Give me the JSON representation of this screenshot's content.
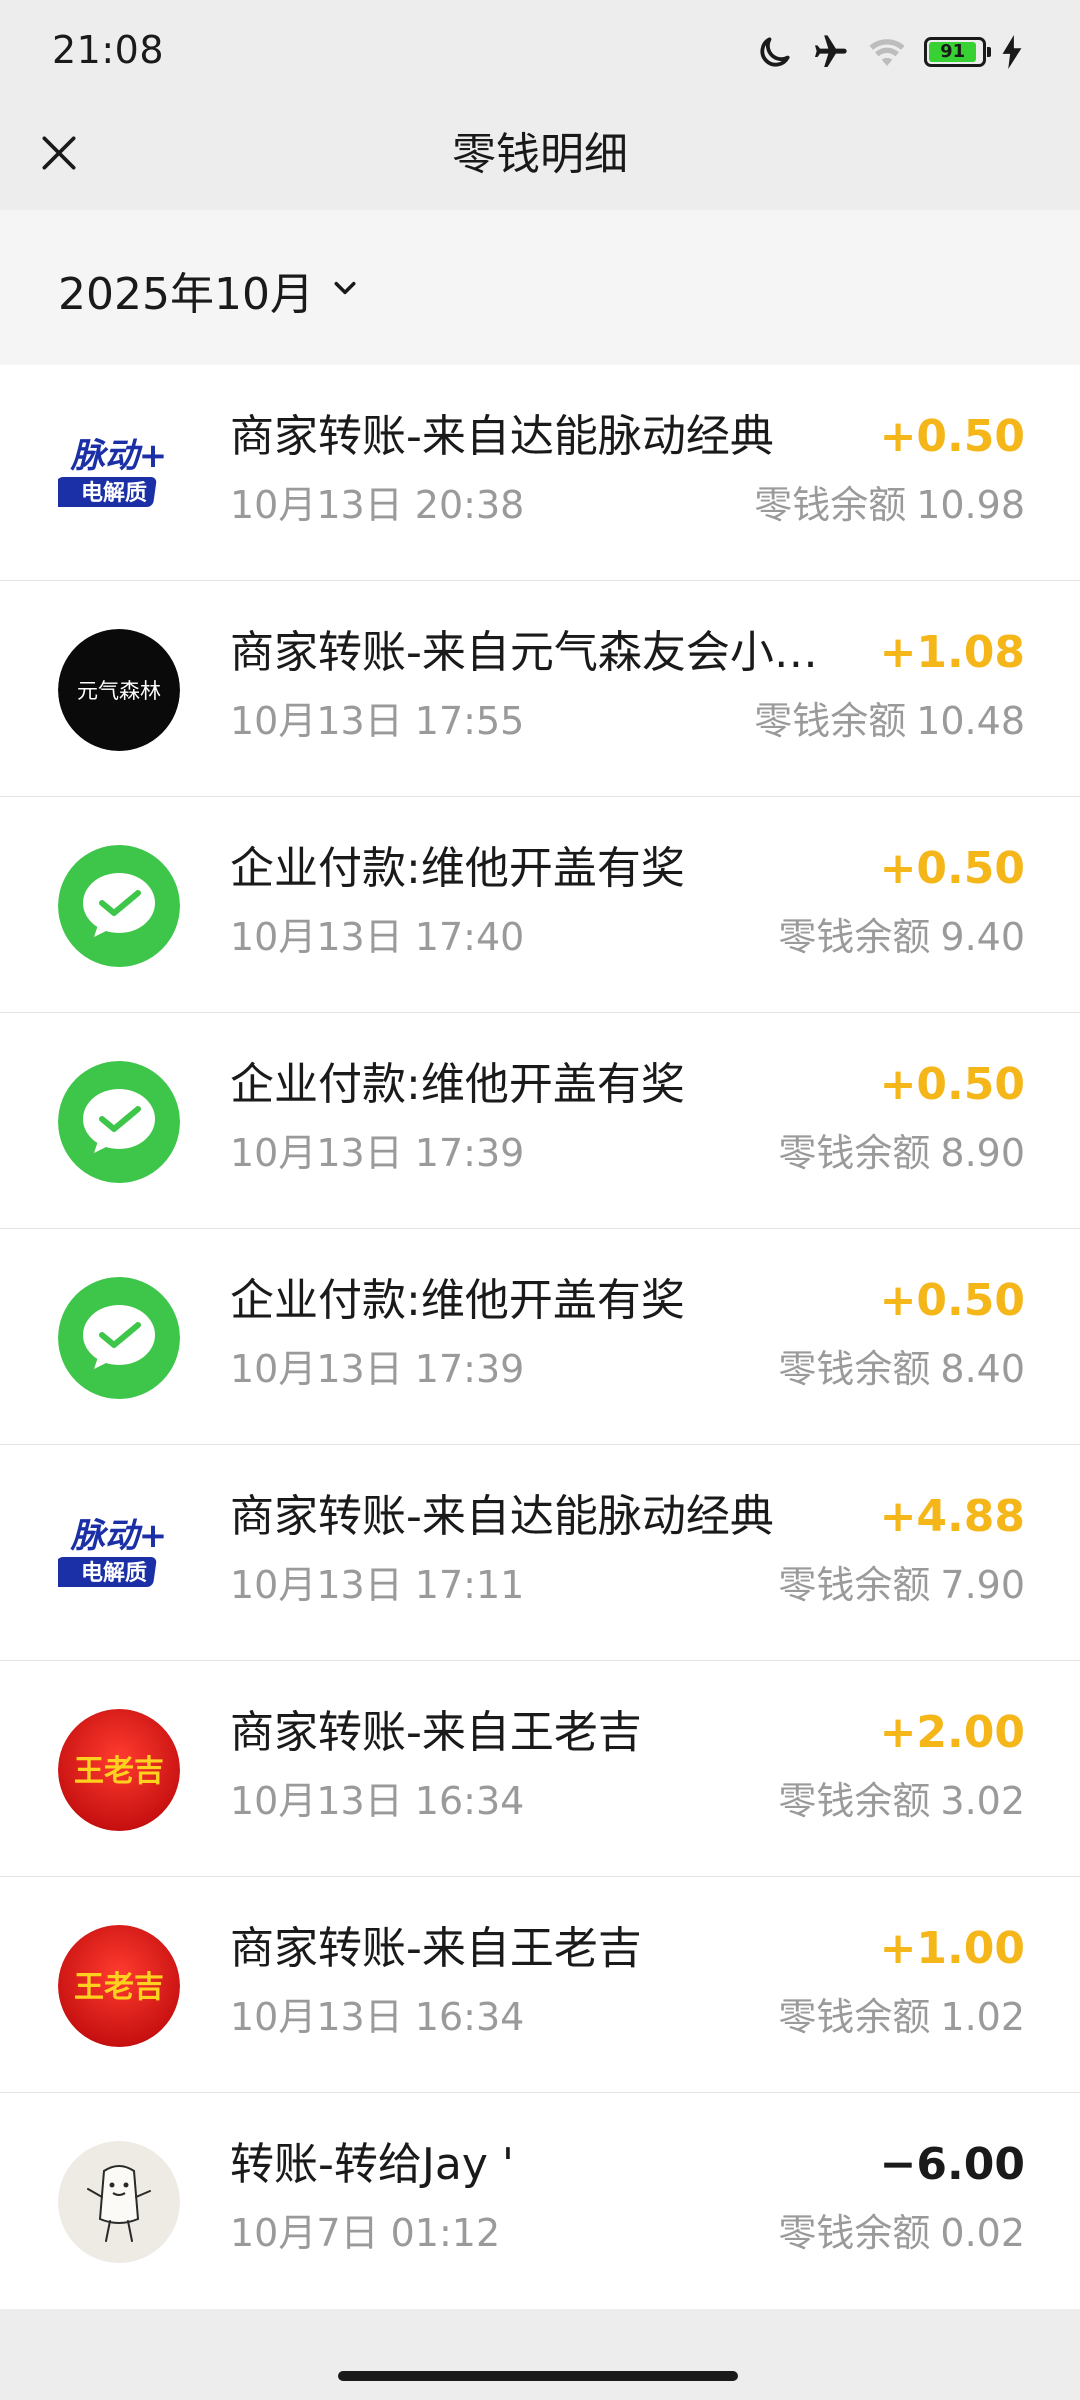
{
  "status_bar": {
    "time": "21:08",
    "battery_level": "91",
    "icons": [
      "moon-icon",
      "airplane-icon",
      "wifi-icon",
      "battery-icon",
      "charging-icon"
    ]
  },
  "nav": {
    "title": "零钱明细",
    "close_icon": "close-icon"
  },
  "filter": {
    "month_label": "2025年10月",
    "chevron_icon": "chevron-down-icon"
  },
  "balance_label": "零钱余额",
  "colors": {
    "income": "#f5b61a",
    "expense": "#1a1a1a",
    "wechat_green": "#3ec64a"
  },
  "transactions": [
    {
      "title": "商家转账-来自达能脉动经典",
      "time": "10月13日 20:38",
      "amount": "+0.50",
      "balance": "10.98",
      "avatar": "maidong-logo",
      "logo_line1": "脉动+",
      "logo_line2": "电解质"
    },
    {
      "title": "商家转账-来自元气森友会小…",
      "time": "10月13日 17:55",
      "amount": "+1.08",
      "balance": "10.48",
      "avatar": "genki-forest-logo",
      "logo_text": "元气森林"
    },
    {
      "title": "企业付款:维他开盖有奖",
      "time": "10月13日 17:40",
      "amount": "+0.50",
      "balance": "9.40",
      "avatar": "wechat-pay-icon"
    },
    {
      "title": "企业付款:维他开盖有奖",
      "time": "10月13日 17:39",
      "amount": "+0.50",
      "balance": "8.90",
      "avatar": "wechat-pay-icon"
    },
    {
      "title": "企业付款:维他开盖有奖",
      "time": "10月13日 17:39",
      "amount": "+0.50",
      "balance": "8.40",
      "avatar": "wechat-pay-icon"
    },
    {
      "title": "商家转账-来自达能脉动经典",
      "time": "10月13日 17:11",
      "amount": "+4.88",
      "balance": "7.90",
      "avatar": "maidong-logo",
      "logo_line1": "脉动+",
      "logo_line2": "电解质"
    },
    {
      "title": "商家转账-来自王老吉",
      "time": "10月13日 16:34",
      "amount": "+2.00",
      "balance": "3.02",
      "avatar": "wanglaoji-logo",
      "logo_text": "王老吉"
    },
    {
      "title": "商家转账-来自王老吉",
      "time": "10月13日 16:34",
      "amount": "+1.00",
      "balance": "1.02",
      "avatar": "wanglaoji-logo",
      "logo_text": "王老吉"
    },
    {
      "title": "转账-转给Jay '",
      "time": "10月7日 01:12",
      "amount": "−6.00",
      "balance": "0.02",
      "avatar": "user-doodle-avatar"
    }
  ]
}
